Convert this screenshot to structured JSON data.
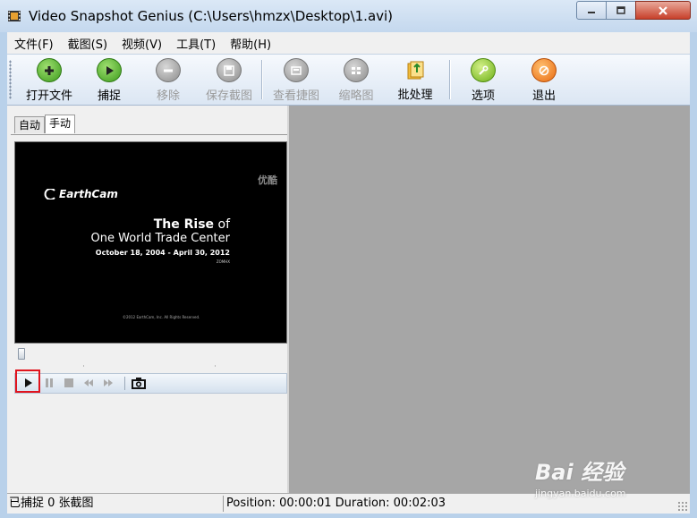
{
  "window": {
    "title": "Video Snapshot Genius (C:\\Users\\hmzx\\Desktop\\1.avi)"
  },
  "menu": {
    "items": [
      "文件(F)",
      "截图(S)",
      "视频(V)",
      "工具(T)",
      "帮助(H)"
    ]
  },
  "toolbar": {
    "buttons": [
      {
        "label": "打开文件",
        "icon": "plus-icon",
        "color": "#4caf2a",
        "enabled": true
      },
      {
        "label": "捕捉",
        "icon": "play-circle-icon",
        "color": "#4caf2a",
        "enabled": true
      },
      {
        "label": "移除",
        "icon": "minus-icon",
        "color": "#8c8c8c",
        "enabled": false
      },
      {
        "label": "保存截图",
        "icon": "floppy-icon",
        "color": "#8c8c8c",
        "enabled": false
      },
      {
        "label": "查看捷图",
        "icon": "view-icon",
        "color": "#8c8c8c",
        "enabled": false
      },
      {
        "label": "缩略图",
        "icon": "thumbnails-icon",
        "color": "#8c8c8c",
        "enabled": false
      },
      {
        "label": "批处理",
        "icon": "batch-icon",
        "color": "#e0a020",
        "enabled": true
      },
      {
        "label": "选项",
        "icon": "wrench-icon",
        "color": "#7cc420",
        "enabled": true
      },
      {
        "label": "退出",
        "icon": "exit-icon",
        "color": "#f07820",
        "enabled": true
      }
    ]
  },
  "tabs": {
    "auto": "自动",
    "manual": "手动"
  },
  "video": {
    "watermark": "优酷",
    "logo": "EarthCam",
    "title_bold": "The Rise",
    "title_rest": " of",
    "subtitle": "One World Trade Center",
    "dates": "October 18, 2004 - April 30, 2012",
    "small": "ZOMHX",
    "copyright": "©2012 EarthCam, Inc. All Rights Reserved."
  },
  "status": {
    "captured": "已捕捉 0 张截图",
    "position_label": "Position:",
    "position": "00:00:01",
    "duration_label": "Duration:",
    "duration": "00:02:03"
  },
  "watermark": {
    "main": "Bai 经验",
    "sub": "jingyan.baidu.com"
  },
  "colors": {
    "highlight": "#e0141e",
    "right_pane": "#a6a6a6"
  }
}
